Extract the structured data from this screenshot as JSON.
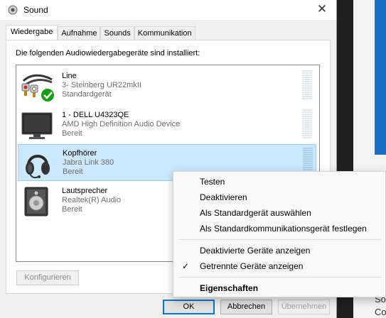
{
  "window": {
    "title": "Sound"
  },
  "tabs": [
    {
      "label": "Wiedergabe"
    },
    {
      "label": "Aufnahme"
    },
    {
      "label": "Sounds"
    },
    {
      "label": "Kommunikation"
    }
  ],
  "instruction": "Die folgenden Audiowiedergabegeräte sind installiert:",
  "devices": [
    {
      "name": "Line",
      "desc": "3- Steinberg UR22mkII",
      "status": "Standardgerät"
    },
    {
      "name": "1 - DELL U4323QE",
      "desc": "AMD High Definition Audio Device",
      "status": "Bereit"
    },
    {
      "name": "Kopfhörer",
      "desc": "Jabra Link 380",
      "status": "Bereit"
    },
    {
      "name": "Lautsprecher",
      "desc": "Realtek(R) Audio",
      "status": "Bereit"
    }
  ],
  "configure_label": "Konfigurieren",
  "buttons": {
    "ok": "OK",
    "cancel": "Abbrechen",
    "apply": "Übernehmen"
  },
  "context_menu": {
    "items": [
      {
        "label": "Testen"
      },
      {
        "label": "Deaktivieren"
      },
      {
        "label": "Als Standardgerät auswählen"
      },
      {
        "label": "Als Standardkommunikationsgerät festlegen"
      },
      {
        "label": "Deaktivierte Geräte anzeigen"
      },
      {
        "label": "Getrennte Geräte anzeigen",
        "checked": true
      },
      {
        "label": "Eigenschaften"
      }
    ],
    "check_glyph": "✓"
  },
  "background_app": {
    "line1": "So",
    "line2": "Co"
  },
  "colors": {
    "selection": "#cce8ff",
    "accent": "#0078d7",
    "default_check": "#13a10e"
  }
}
